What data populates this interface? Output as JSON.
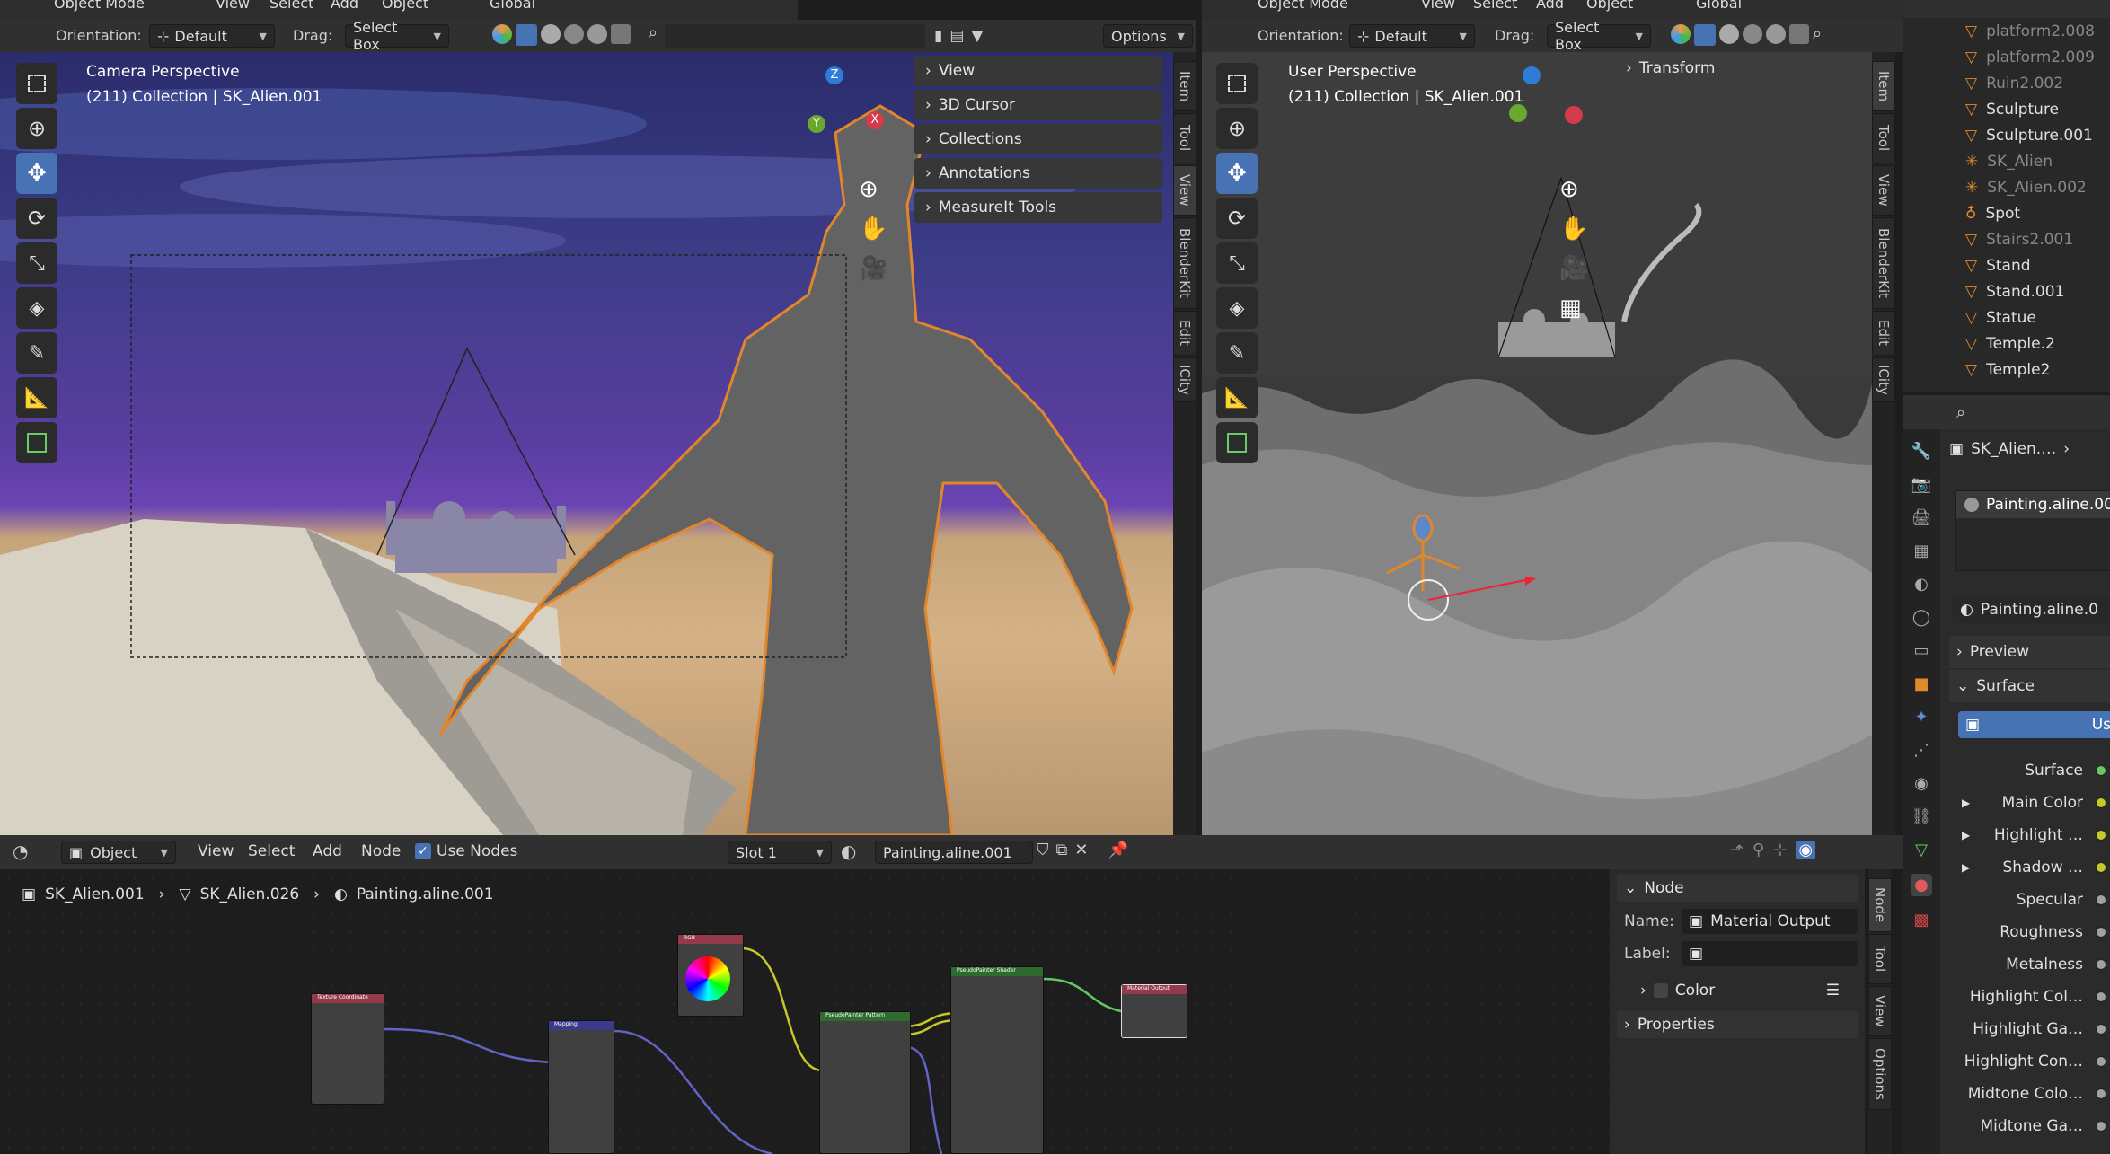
{
  "left_viewport": {
    "mode": "Object Mode",
    "menus": [
      "View",
      "Select",
      "Add",
      "Object"
    ],
    "transform": "Global",
    "orientation_label": "Orientation:",
    "orientation_value": "Default",
    "drag_label": "Drag:",
    "drag_value": "Select Box",
    "options_label": "Options",
    "view_title": "Camera Perspective",
    "collection_info": "(211) Collection | SK_Alien.001",
    "npanel_items": [
      "View",
      "3D Cursor",
      "Collections",
      "Annotations",
      "MeasureIt Tools"
    ],
    "side_tabs": [
      "Item",
      "Tool",
      "View",
      "BlenderKit",
      "Edit",
      "ICity"
    ],
    "gizmo": {
      "z": "Z",
      "y": "Y",
      "x": "X"
    }
  },
  "right_viewport": {
    "mode": "Object Mode",
    "menus": [
      "View",
      "Select",
      "Add",
      "Object"
    ],
    "transform": "Global",
    "orientation_label": "Orientation:",
    "orientation_value": "Default",
    "drag_label": "Drag:",
    "drag_value": "Select Box",
    "view_title": "User Perspective",
    "collection_info": "(211) Collection | SK_Alien.001",
    "transform_panel": "Transform",
    "side_tabs": [
      "Item",
      "Tool",
      "View",
      "BlenderKit",
      "Edit",
      "ICity"
    ]
  },
  "outliner": {
    "items": [
      "platform2.008",
      "platform2.009",
      "Ruin2.002",
      "Sculpture",
      "Sculpture.001",
      "SK_Alien",
      "SK_Alien.002",
      "Spot",
      "Stairs2.001",
      "Stand",
      "Stand.001",
      "Statue",
      "Temple.2",
      "Temple2"
    ]
  },
  "properties": {
    "object_name": "SK_Alien.…",
    "material_slot": "Painting.aline.00",
    "material_name": "Painting.aline.0",
    "preview_label": "Preview",
    "surface_section": "Surface",
    "use_nodes_btn": "Us",
    "rows": [
      "Surface",
      "Main Color",
      "Highlight …",
      "Shadow …",
      "Specular",
      "Roughness",
      "Metalness",
      "Highlight Col…",
      "Highlight Ga…",
      "Highlight Con…",
      "Midtone Colo…",
      "Midtone Ga…"
    ]
  },
  "node_editor": {
    "editor_type": "Object",
    "menus": [
      "View",
      "Select",
      "Add",
      "Node"
    ],
    "use_nodes": "Use Nodes",
    "slot": "Slot 1",
    "material": "Painting.aline.001",
    "breadcrumb": [
      "SK_Alien.001",
      "SK_Alien.026",
      "Painting.aline.001"
    ],
    "side_tabs": [
      "Node",
      "Tool",
      "View",
      "Options"
    ],
    "node_panel": {
      "title": "Node",
      "name_label": "Name:",
      "name_value": "Material Output",
      "label_label": "Label:",
      "label_value": "",
      "color_label": "Color",
      "properties_label": "Properties"
    },
    "nodes": {
      "texcoord": "Texture Coordinate",
      "mapping": "Mapping",
      "rgb": "RGB",
      "pattern": "PseudoPainter Pattern",
      "shader": "PseudoPainter Shader",
      "output": "Material Output"
    }
  }
}
